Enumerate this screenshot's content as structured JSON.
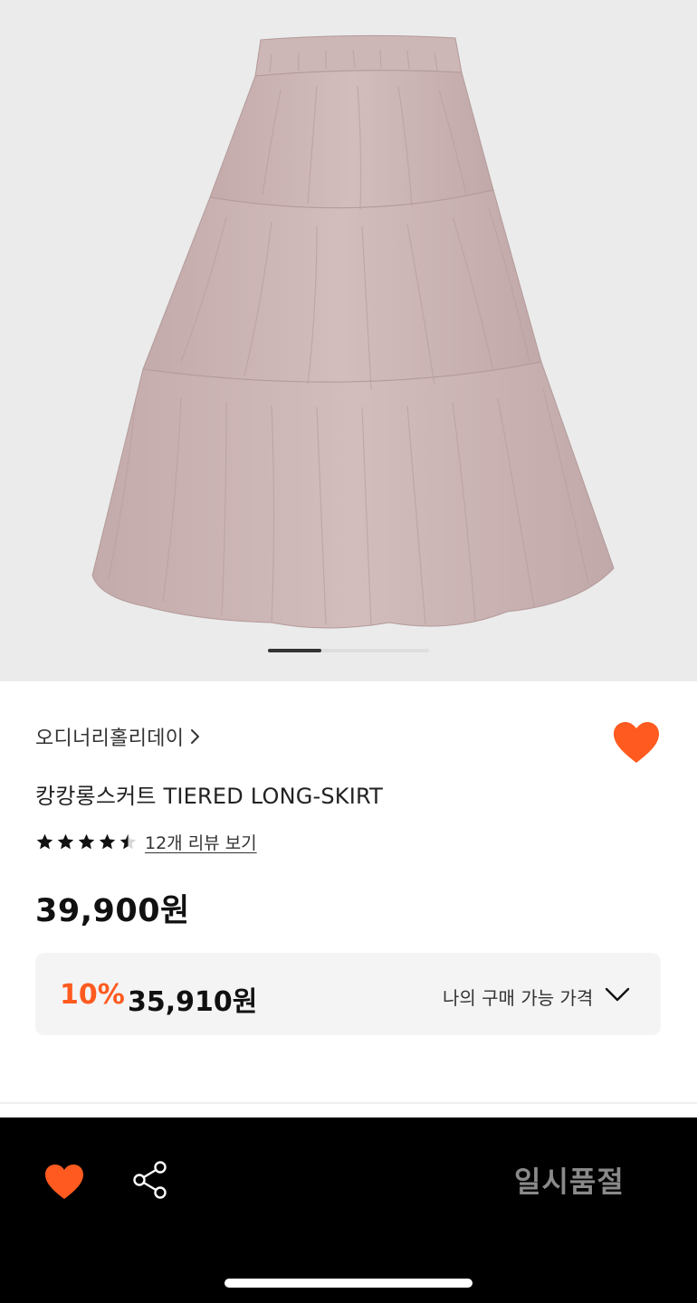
{
  "product": {
    "brand": "오디너리홀리데이",
    "title": "캉캉롱스커트 TIERED LONG-SKIRT",
    "rating": 4.5,
    "review_link": "12개 리뷰 보기",
    "price": "39,900원",
    "discount": {
      "rate": "10%",
      "price": "35,910원",
      "label": "나의 구매 가능 가격"
    },
    "image_count_indicator": {
      "current": 1,
      "segments": 3
    }
  },
  "bottom_bar": {
    "soldout_label": "일시품절"
  },
  "icons": {
    "brand_chevron": "chevron-right-icon",
    "wish": "heart-icon",
    "share": "share-icon",
    "expand": "chevron-down-icon",
    "star": "star-icon"
  },
  "colors": {
    "accent": "#ff5a1f",
    "image_bg": "#ebebeb",
    "skirt": "#cbb3b3",
    "bottom_bar": "#000000",
    "soldout_text": "#8a8a8a"
  }
}
